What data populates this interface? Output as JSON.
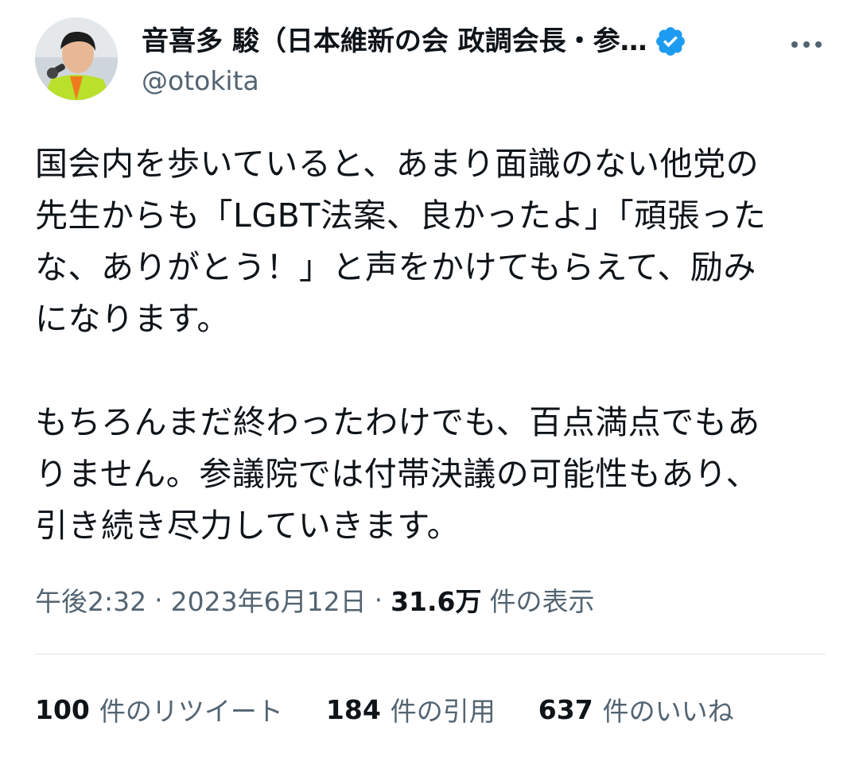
{
  "author": {
    "display_name": "音喜多 駿（日本維新の会 政調会長・参…",
    "handle": "@otokita",
    "verified_icon": "verified-badge-icon",
    "avatar_icon": "user-avatar"
  },
  "menu": {
    "more_icon": "more-options-icon"
  },
  "tweet": {
    "paragraphs": [
      "国会内を歩いていると、あまり面識のない他党の\n先生からも「LGBT法案、良かったよ」「頑張った\nな、ありがとう！」と声をかけてもらえて、励み\nになります。",
      "もちろんまだ終わったわけでも、百点満点でもあ\nりません。参議院では付帯決議の可能性もあり、\n引き続き尽力していきます。"
    ]
  },
  "meta": {
    "time": "午後2:32",
    "separator": "·",
    "date": "2023年6月12日",
    "views_count": "31.6万",
    "views_label": "件の表示"
  },
  "stats": {
    "retweets": {
      "count": "100",
      "label": "件のリツイート"
    },
    "quotes": {
      "count": "184",
      "label": "件の引用"
    },
    "likes": {
      "count": "637",
      "label": "件のいいね"
    }
  },
  "colors": {
    "text_primary": "#0f1419",
    "text_secondary": "#536471",
    "verified_blue": "#1d9bf0",
    "divider": "#e1e8ed"
  }
}
